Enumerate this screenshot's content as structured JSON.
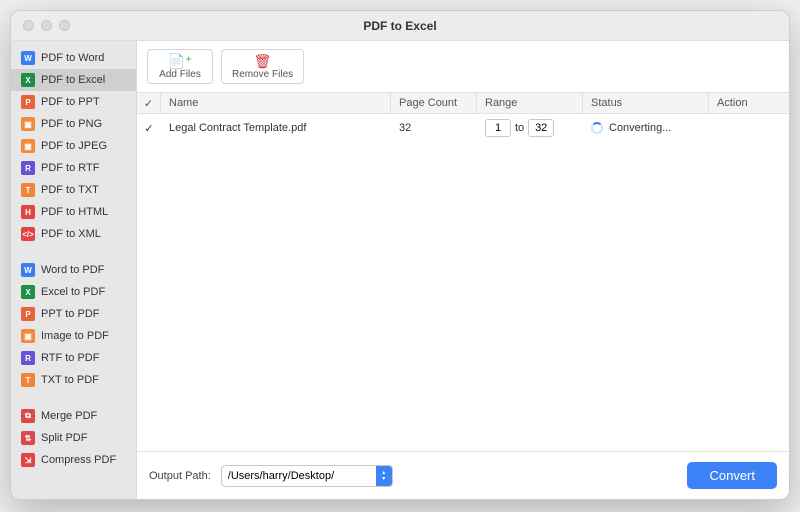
{
  "window": {
    "title": "PDF to Excel"
  },
  "sidebar": {
    "groups": [
      [
        {
          "icon": "W",
          "bg": "#3b7ef0",
          "label": "PDF to Word"
        },
        {
          "icon": "X",
          "bg": "#1f8f46",
          "label": "PDF to Excel",
          "selected": true
        },
        {
          "icon": "P",
          "bg": "#e2643a",
          "label": "PDF to PPT"
        },
        {
          "icon": "▣",
          "bg": "#f48a3b",
          "label": "PDF to PNG"
        },
        {
          "icon": "▣",
          "bg": "#f48a3b",
          "label": "PDF to JPEG"
        },
        {
          "icon": "R",
          "bg": "#6a52d6",
          "label": "PDF to RTF"
        },
        {
          "icon": "T",
          "bg": "#f0853a",
          "label": "PDF to TXT"
        },
        {
          "icon": "H",
          "bg": "#e24545",
          "label": "PDF to HTML"
        },
        {
          "icon": "</>",
          "bg": "#e24545",
          "label": "PDF to XML"
        }
      ],
      [
        {
          "icon": "W",
          "bg": "#3b7ef0",
          "label": "Word to PDF"
        },
        {
          "icon": "X",
          "bg": "#1f8f46",
          "label": "Excel to PDF"
        },
        {
          "icon": "P",
          "bg": "#e2643a",
          "label": "PPT to PDF"
        },
        {
          "icon": "▣",
          "bg": "#f48a3b",
          "label": "Image to PDF"
        },
        {
          "icon": "R",
          "bg": "#6a52d6",
          "label": "RTF to PDF"
        },
        {
          "icon": "T",
          "bg": "#f0853a",
          "label": "TXT to PDF"
        }
      ],
      [
        {
          "icon": "⧉",
          "bg": "#d94b4b",
          "label": "Merge PDF"
        },
        {
          "icon": "⇅",
          "bg": "#d94b4b",
          "label": "Split PDF"
        },
        {
          "icon": "⇲",
          "bg": "#e24545",
          "label": "Compress PDF"
        }
      ]
    ]
  },
  "toolbar": {
    "add_label": "Add Files",
    "remove_label": "Remove Files"
  },
  "table": {
    "headers": {
      "check": "✓",
      "name": "Name",
      "page": "Page Count",
      "range": "Range",
      "status": "Status",
      "action": "Action"
    },
    "rows": [
      {
        "checked": "✓",
        "name": "Legal Contract Template.pdf",
        "page_count": "32",
        "range_from": "1",
        "range_to": "32",
        "range_sep": "to",
        "status": "Converting..."
      }
    ]
  },
  "footer": {
    "output_label": "Output Path:",
    "output_path": "/Users/harry/Desktop/",
    "convert_label": "Convert"
  }
}
